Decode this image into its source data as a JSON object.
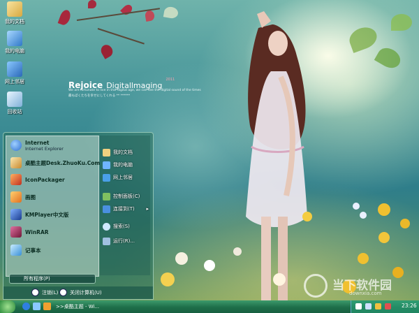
{
  "desktop": {
    "icons": [
      {
        "label": "我的文档",
        "icon": "my-documents-icon",
        "color": "#f0d080"
      },
      {
        "label": "我的电脑",
        "icon": "my-computer-icon",
        "color": "#6fb6ff"
      },
      {
        "label": "网上邻居",
        "icon": "network-places-icon",
        "color": "#4aa0e8"
      },
      {
        "label": "回收站",
        "icon": "recycle-bin-icon",
        "color": "#cfe8ff"
      }
    ],
    "wallpaper_text": {
      "brand": "Rejoice",
      "brand2": "Digitallmaging",
      "year": "2011",
      "line1": "We are fortunate to live in this digital age, we can see the digital sound of the times",
      "line2": "最もぼくたちを幸せにしてくれる ** ******"
    },
    "watermark": {
      "name": "当下软件园",
      "url": "downxia.com"
    }
  },
  "start_menu": {
    "left_items": [
      {
        "title": "Internet",
        "subtitle": "Internet Explorer",
        "icon": "internet-explorer-icon",
        "color": "#2f7fe0"
      },
      {
        "title": "桌酷主题Desk.ZhuoKu.Com",
        "subtitle": "",
        "icon": "zhuoku-theme-icon",
        "color": "#e8c070"
      },
      {
        "title": "IconPackager",
        "subtitle": "",
        "icon": "iconpackager-icon",
        "color": "#e05a2a"
      },
      {
        "title": "画图",
        "subtitle": "",
        "icon": "paint-icon",
        "color": "#f0a030"
      },
      {
        "title": "KMPlayer中文版",
        "subtitle": "",
        "icon": "kmplayer-icon",
        "color": "#3a6fd0"
      },
      {
        "title": "WinRAR",
        "subtitle": "",
        "icon": "winrar-icon",
        "color": "#b03060"
      },
      {
        "title": "记事本",
        "subtitle": "",
        "icon": "notepad-icon",
        "color": "#5ab0f0"
      }
    ],
    "right_items": [
      {
        "label": "我的文档",
        "icon": "my-documents-icon",
        "color": "#f0d080"
      },
      {
        "label": "我的电脑",
        "icon": "my-computer-icon",
        "color": "#6fb6ff"
      },
      {
        "label": "网上邻居",
        "icon": "network-places-icon",
        "color": "#4aa0e8"
      },
      {
        "label": "控制面板(C)",
        "icon": "control-panel-icon",
        "color": "#80c060"
      },
      {
        "label": "连接到(T)",
        "icon": "connect-to-icon",
        "color": "#4a90e0",
        "arrow": "▸"
      },
      {
        "label": "搜索(S)",
        "icon": "search-icon",
        "color": "#d0e8ff"
      },
      {
        "label": "运行(R)...",
        "icon": "run-icon",
        "color": "#a0c0e0"
      }
    ],
    "all_programs": "所有程序(P)",
    "logoff": "注销(L)",
    "shutdown": "关闭计算机(U)"
  },
  "taskbar": {
    "task_button": ">>桌酷主题 - Wi...",
    "clock": "23:26"
  }
}
